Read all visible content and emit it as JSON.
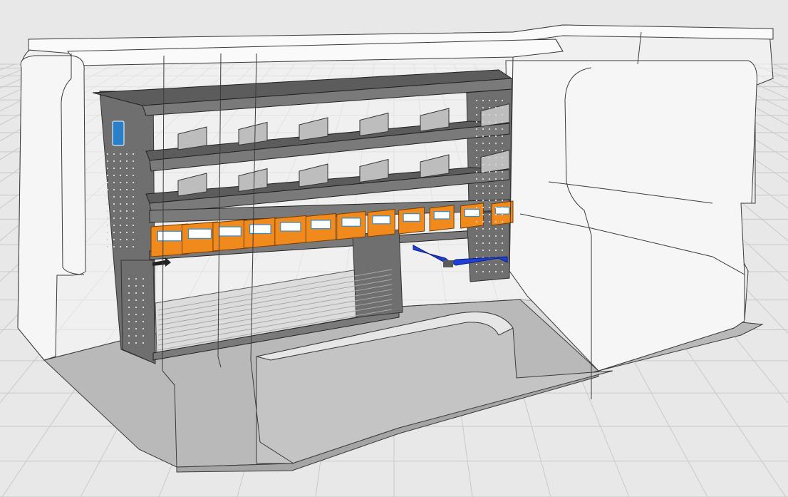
{
  "viewer": {
    "background_color": "#e8e8e8",
    "grid_color": "#c9c9c9"
  },
  "vehicle": {
    "wall_color": "#f6f6f6",
    "wall_stroke": "#3a3a3a",
    "floor_color": "#b9b9b9",
    "wheel_arch_color": "#c4c4c4"
  },
  "racking": {
    "frame_color": "#6f6f6f",
    "shelf_color": "#5c5c5c",
    "divider_color": "#bdbdbd",
    "bin_color": "#f08a1c",
    "bin_label_color": "#ffffff",
    "bin_label_stroke": "#2d8fd6",
    "bins_count": 12,
    "strap_color": "#1f3fd6",
    "logo_color": "#2a7fc9",
    "roller_drawer_color": "#dcdcdc"
  }
}
